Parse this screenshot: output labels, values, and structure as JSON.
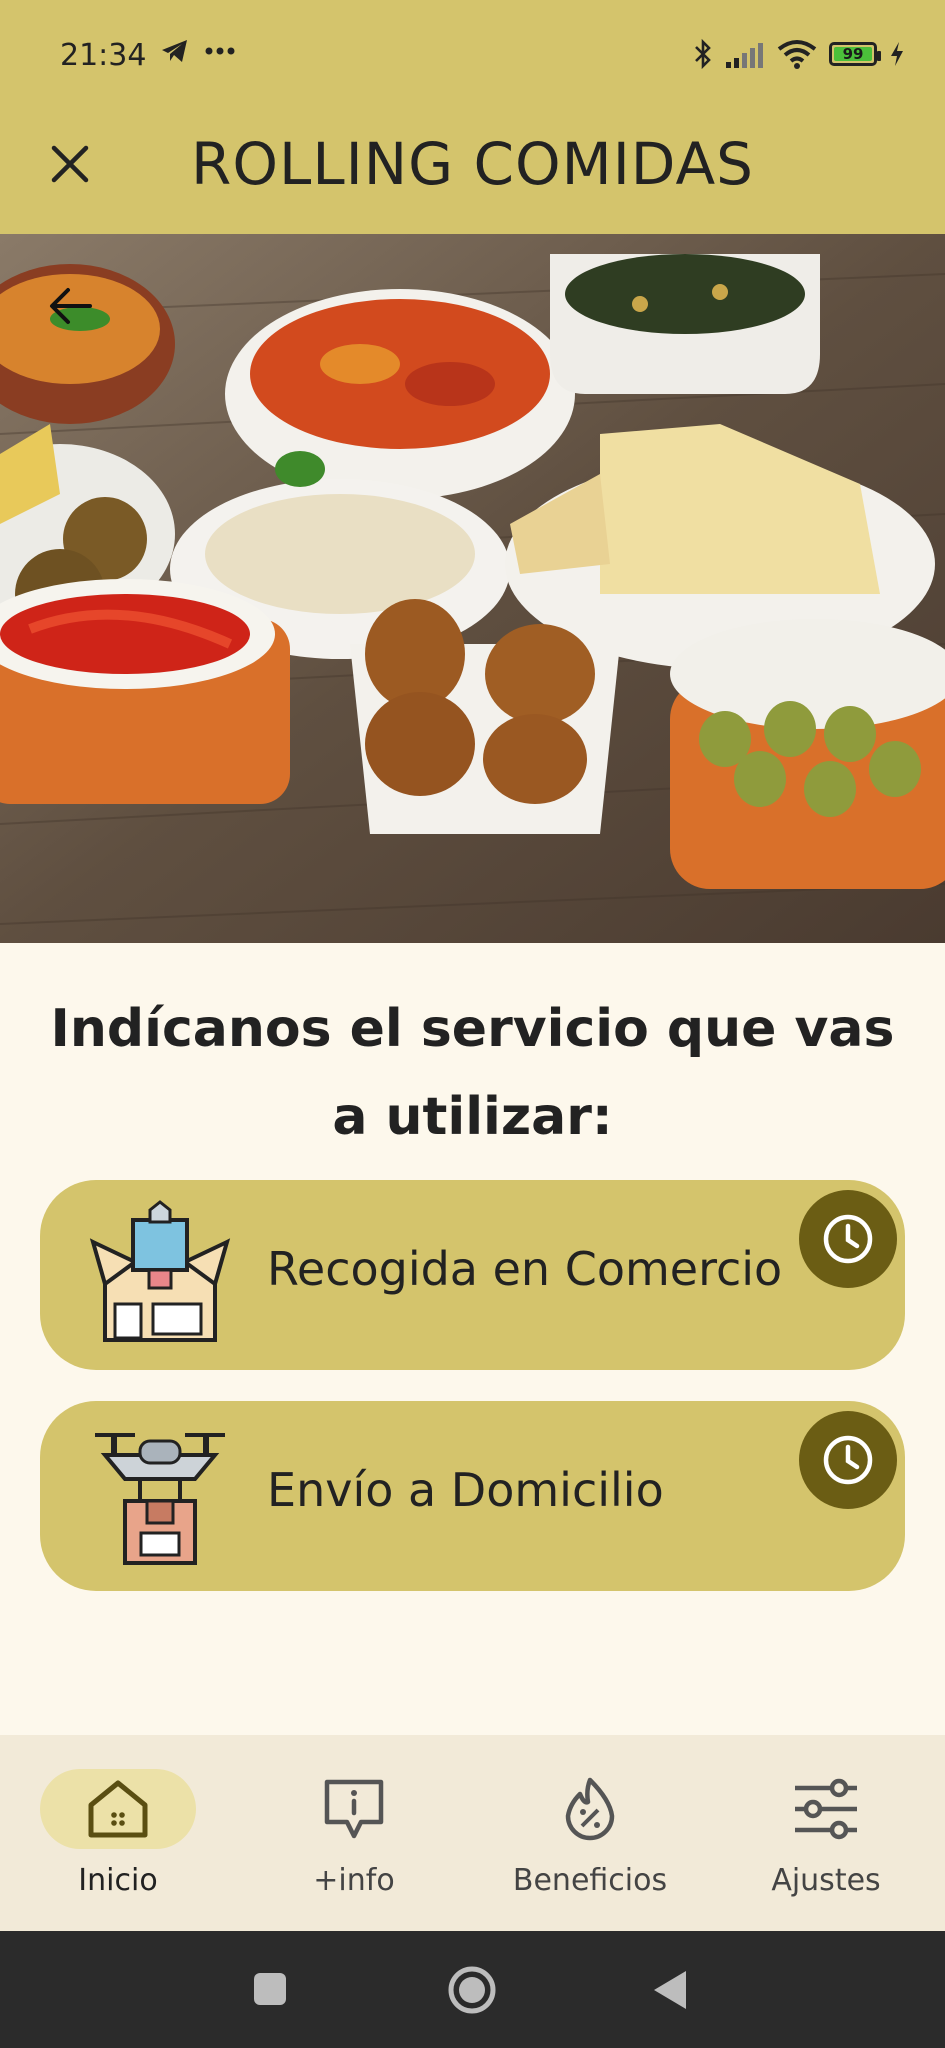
{
  "status_bar": {
    "time": "21:34",
    "notification_icons": [
      "telegram-icon",
      "more-dots-icon"
    ],
    "system_icons": [
      "bluetooth-icon",
      "signal-icon",
      "wifi-icon",
      "battery-icon",
      "charging-icon"
    ],
    "battery_level": "99"
  },
  "app_bar": {
    "title": "ROLLING COMIDAS",
    "close_icon": "close-icon"
  },
  "hero": {
    "back_icon": "arrow-left-icon",
    "image": "spanish-tapas-dishes"
  },
  "prompt": {
    "text": "Indícanos el servicio que vas a utilizar:"
  },
  "services": [
    {
      "label": "Recogida en Comercio",
      "icon": "store-pickup-icon",
      "schedule_icon": "clock-icon"
    },
    {
      "label": "Envío a Domicilio",
      "icon": "drone-delivery-icon",
      "schedule_icon": "clock-icon"
    }
  ],
  "bottom_nav": {
    "items": [
      {
        "label": "Inicio",
        "icon": "home-icon",
        "active": true
      },
      {
        "label": "+info",
        "icon": "info-message-icon",
        "active": false
      },
      {
        "label": "Beneficios",
        "icon": "discount-icon",
        "active": false
      },
      {
        "label": "Ajustes",
        "icon": "sliders-icon",
        "active": false
      }
    ]
  },
  "colors": {
    "accent": "#d4c46c",
    "clock_button": "#6b5d14",
    "background": "#fdf8ec",
    "nav_background": "#f2ead8",
    "nav_active_pill": "#ece1a8"
  }
}
